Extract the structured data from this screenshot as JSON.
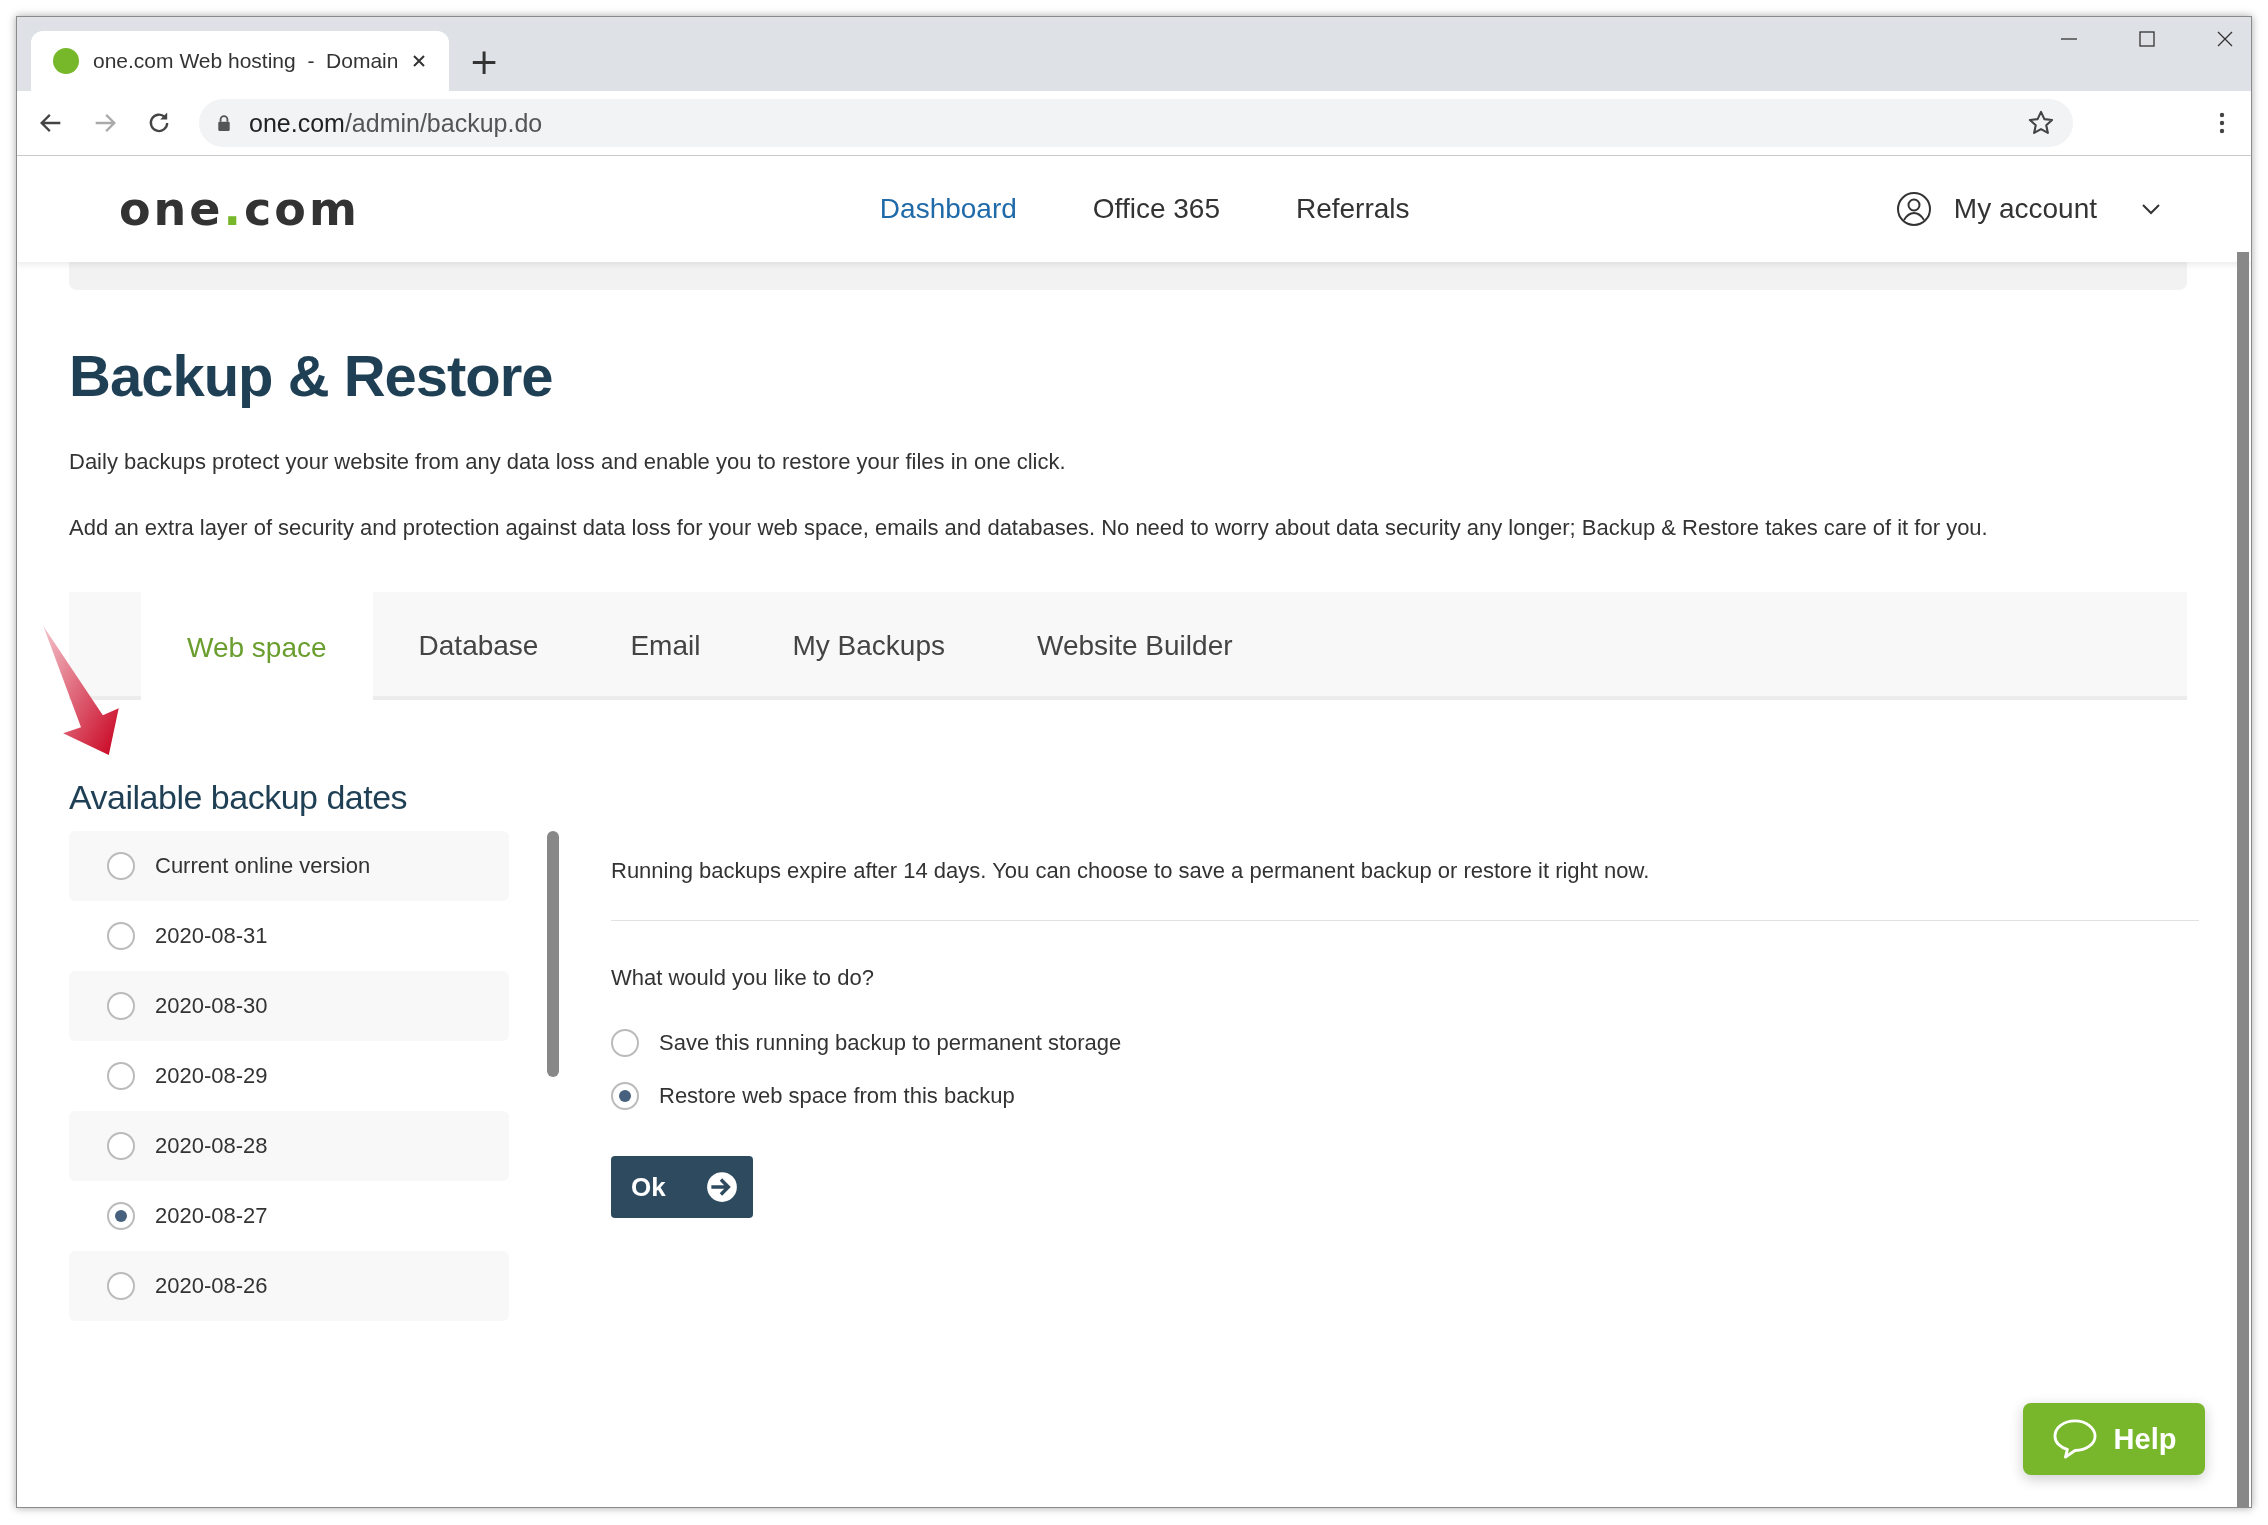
{
  "browser": {
    "tab_title": "one.com Web hosting  -  Domain",
    "new_tab": "+",
    "url_host": "one.com",
    "url_path": "/admin/backup.do"
  },
  "header": {
    "logo": {
      "before": "one",
      "dot": ".",
      "after": "com"
    },
    "nav": [
      {
        "label": "Dashboard",
        "selected": true
      },
      {
        "label": "Office 365",
        "selected": false
      },
      {
        "label": "Referrals",
        "selected": false
      }
    ],
    "account": "My account"
  },
  "page": {
    "title": "Backup & Restore",
    "paragraphs": [
      "Daily backups protect your website from any data loss and enable you to restore your files in one click.",
      "Add an extra layer of security and protection against data loss for your web space, emails and databases. No need to worry about data security any longer; Backup & Restore takes care of it for you."
    ],
    "tabs": [
      {
        "label": "Web space",
        "selected": true
      },
      {
        "label": "Database",
        "selected": false
      },
      {
        "label": "Email",
        "selected": false
      },
      {
        "label": "My Backups",
        "selected": false
      },
      {
        "label": "Website Builder",
        "selected": false
      }
    ],
    "dates_heading": "Available backup dates",
    "dates": [
      {
        "label": "Current online version",
        "selected": false
      },
      {
        "label": "2020-08-31",
        "selected": false
      },
      {
        "label": "2020-08-30",
        "selected": false
      },
      {
        "label": "2020-08-29",
        "selected": false
      },
      {
        "label": "2020-08-28",
        "selected": false
      },
      {
        "label": "2020-08-27",
        "selected": true
      },
      {
        "label": "2020-08-26",
        "selected": false
      }
    ],
    "info": "Running backups expire after 14 days. You can choose to save a permanent backup or restore it right now.",
    "question": "What would you like to do?",
    "options": [
      {
        "label": "Save this running backup to permanent storage",
        "selected": false
      },
      {
        "label": "Restore web space from this backup",
        "selected": true
      }
    ],
    "ok_button": "Ok",
    "help_button": "Help"
  }
}
